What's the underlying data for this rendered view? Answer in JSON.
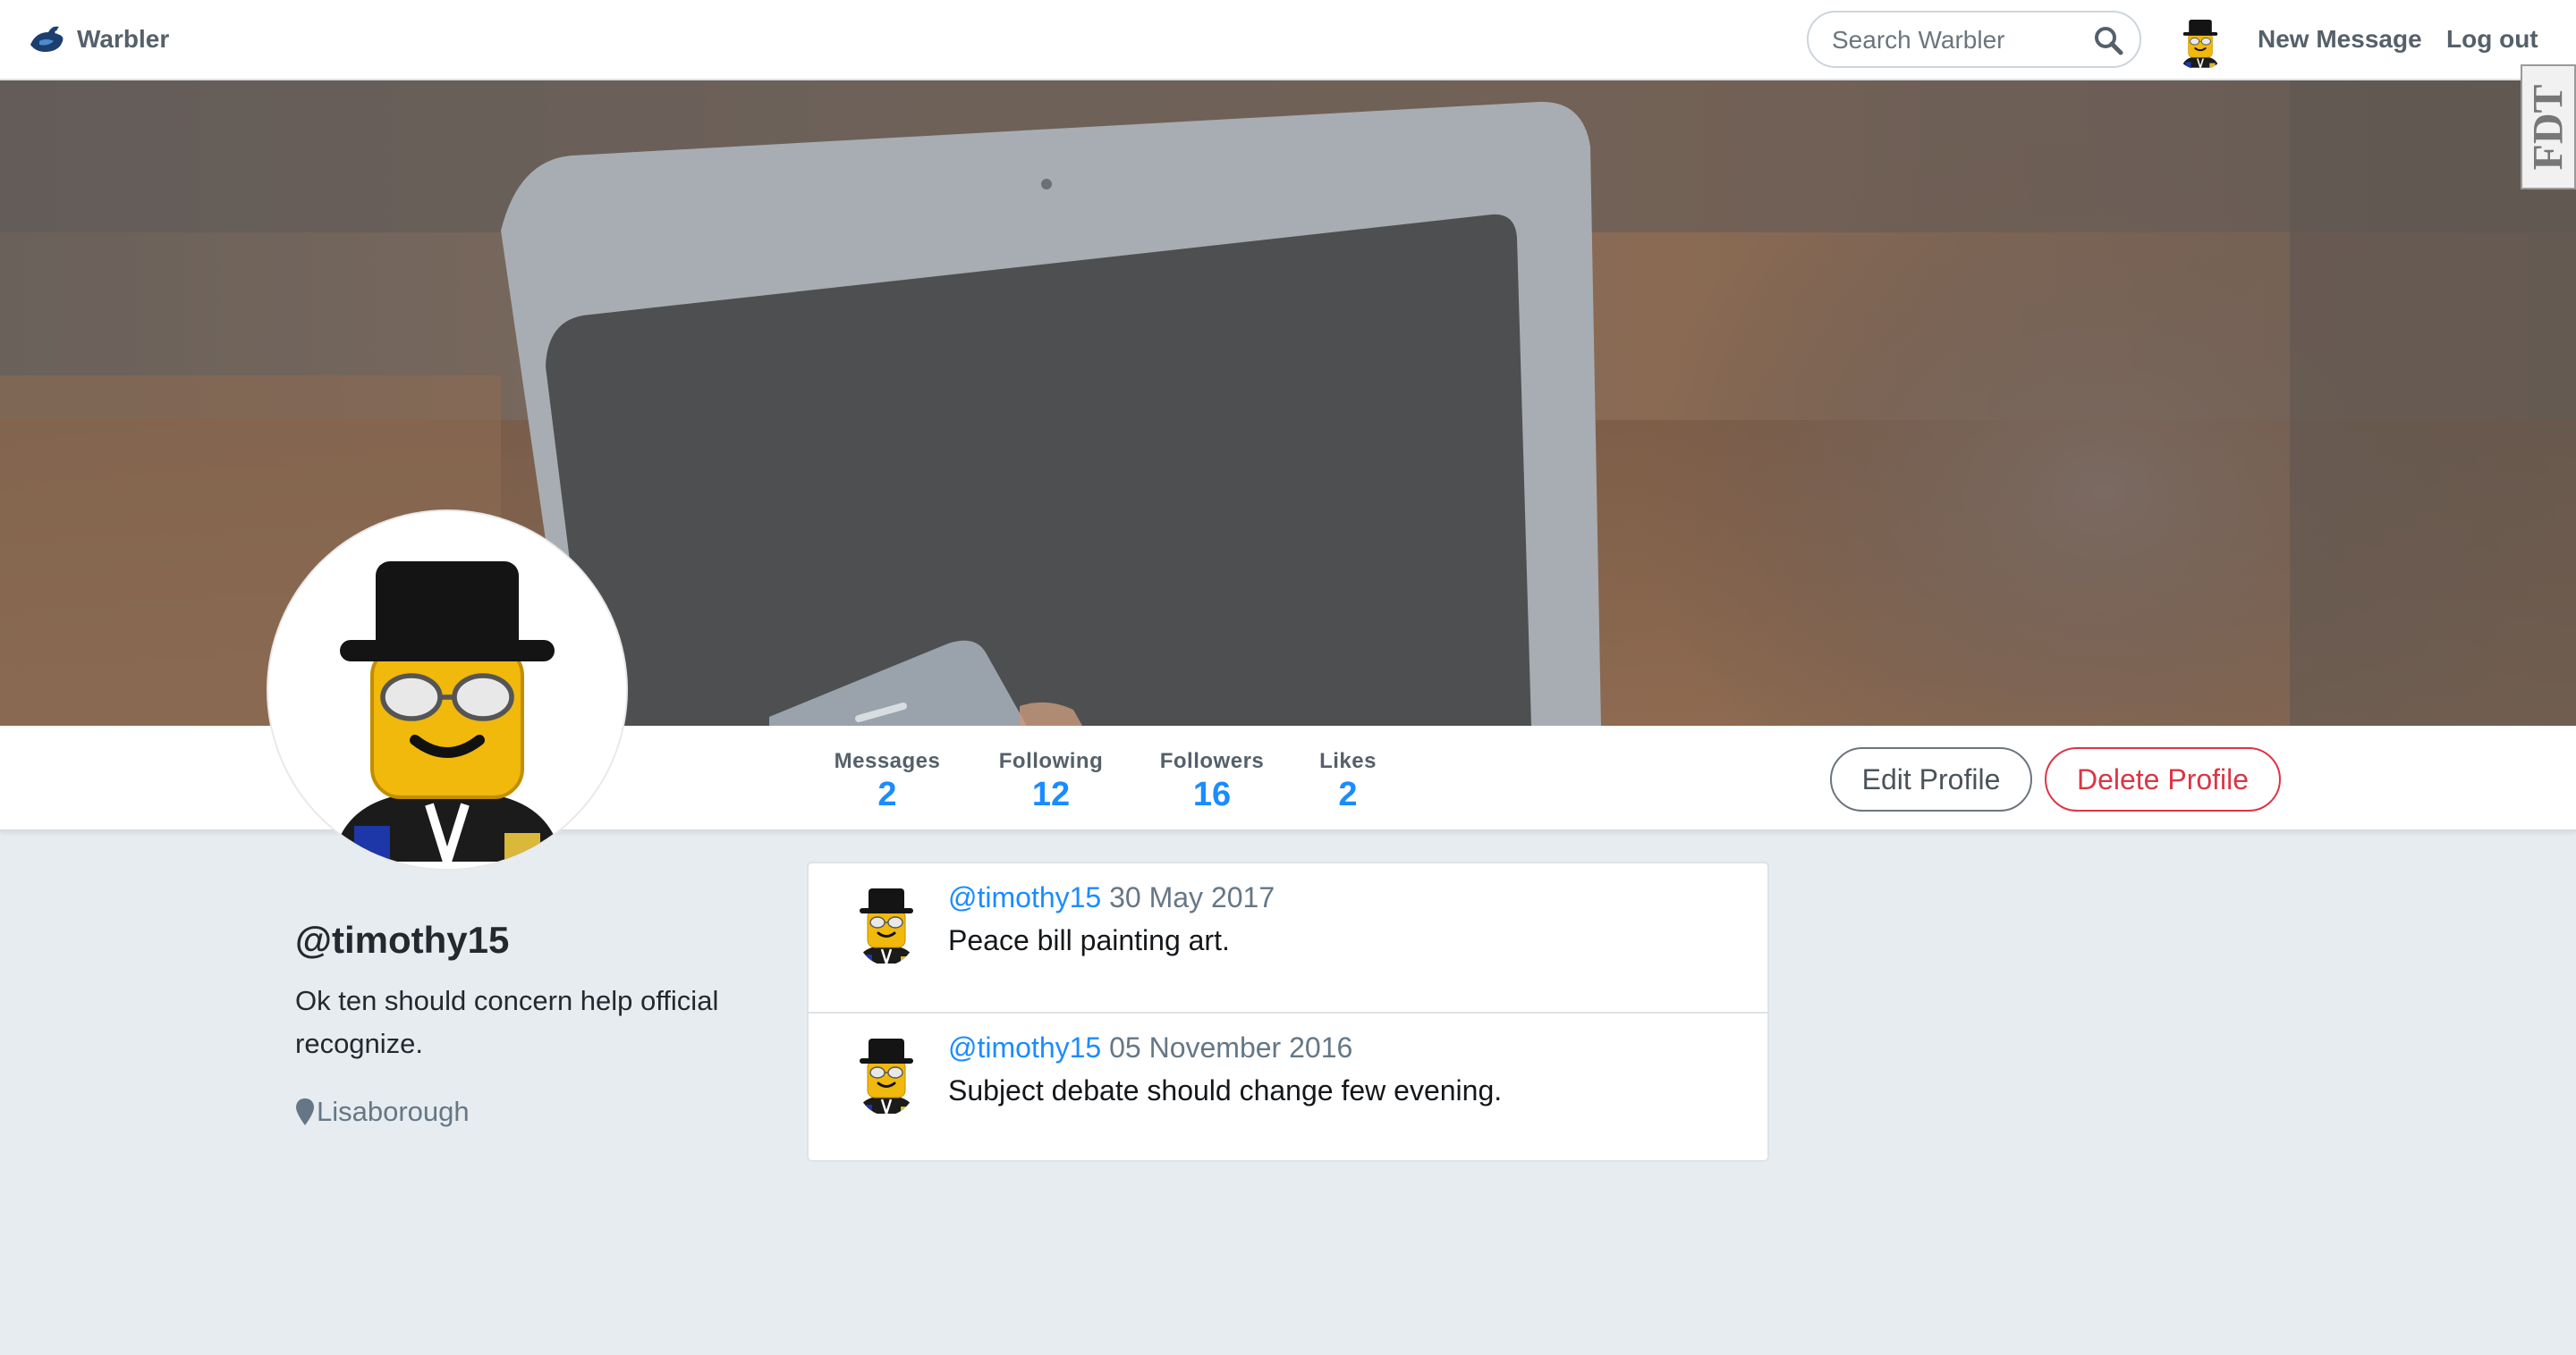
{
  "app": {
    "brand": "Warbler"
  },
  "nav": {
    "search_placeholder": "Search Warbler",
    "new_message": "New Message",
    "logout": "Log out",
    "edge_badge": "FDT"
  },
  "profile": {
    "username": "@timothy15",
    "bio": "Ok ten should concern help official recognize.",
    "location": "Lisaborough",
    "stats": [
      {
        "label": "Messages",
        "value": "2"
      },
      {
        "label": "Following",
        "value": "12"
      },
      {
        "label": "Followers",
        "value": "16"
      },
      {
        "label": "Likes",
        "value": "2"
      }
    ],
    "edit_button": "Edit Profile",
    "delete_button": "Delete Profile"
  },
  "messages": [
    {
      "user": "@timothy15",
      "date": "30 May 2017",
      "text": "Peace bill painting art."
    },
    {
      "user": "@timothy15",
      "date": "05 November 2016",
      "text": "Subject debate should change few evening."
    }
  ],
  "colors": {
    "accent": "#1a8cff",
    "danger": "#dc3545",
    "page_bg": "#e6ecf0",
    "nav_text": "#55606a"
  },
  "icons": {
    "brand": "bird-logo-icon",
    "search": "search-icon",
    "location": "map-pin-icon"
  }
}
